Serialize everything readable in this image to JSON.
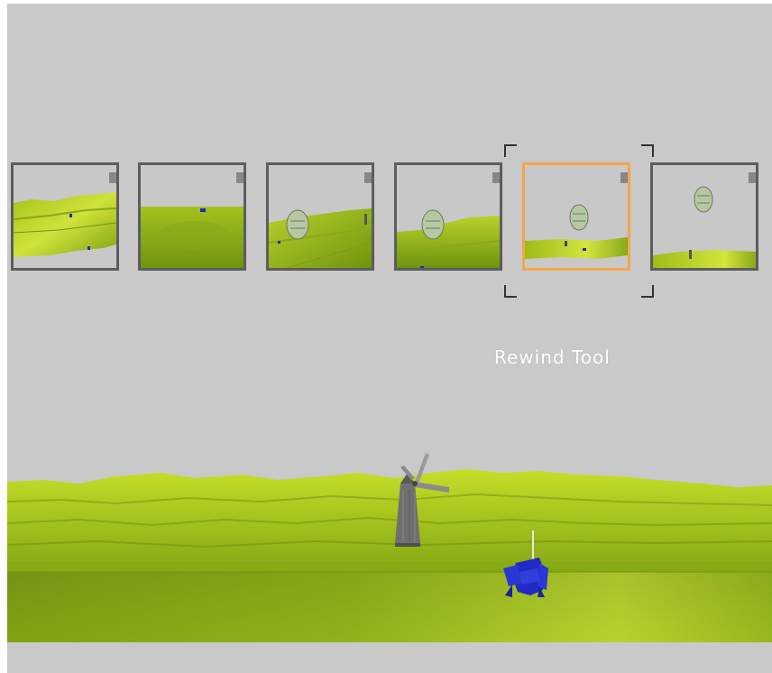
{
  "tool": {
    "label": "Rewind Tool"
  },
  "rewind": {
    "frame_count": 6,
    "selected_frame": 5,
    "frames": [
      {
        "index": 1,
        "selected": false
      },
      {
        "index": 2,
        "selected": false
      },
      {
        "index": 3,
        "selected": false
      },
      {
        "index": 4,
        "selected": false
      },
      {
        "index": 5,
        "selected": true
      },
      {
        "index": 6,
        "selected": false
      }
    ]
  },
  "colors": {
    "sky": "#c9c9c9",
    "grass_light": "#c7dd2a",
    "grass_dark": "#6f9410",
    "thumb_border": "#5d5d5d",
    "selected_border": "#f5a54a",
    "unit_blue": "#1f2bc4",
    "windmill": "#6e6e6e",
    "label_text": "#ffffff"
  },
  "scene": {
    "objects": [
      "windmill",
      "blue-robot-unit"
    ]
  }
}
